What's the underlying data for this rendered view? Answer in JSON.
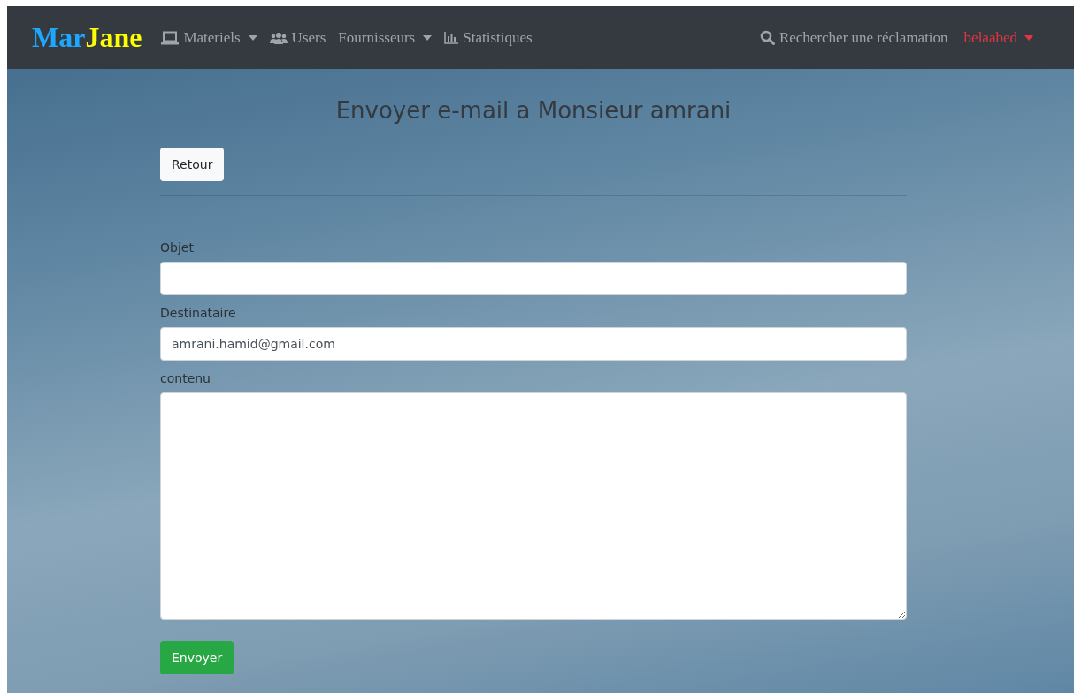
{
  "navbar": {
    "logo": [
      {
        "text": "Mar",
        "color": "#1ea7fd"
      },
      {
        "text": "Jane",
        "color": "#ffff00"
      }
    ],
    "items": [
      {
        "label": "Materiels",
        "dropdown": true
      },
      {
        "label": "Users",
        "dropdown": false
      },
      {
        "label": "Fournisseurs",
        "dropdown": true
      },
      {
        "label": "Statistiques",
        "dropdown": false
      }
    ],
    "search_link": "Rechercher une réclamation",
    "user": {
      "label": "belaabed",
      "dropdown": true
    }
  },
  "page": {
    "title": "Envoyer e-mail a Monsieur amrani",
    "back_button": "Retour",
    "fields": [
      {
        "label": "Objet",
        "kind": "input"
      },
      {
        "label": "Destinataire",
        "kind": "input",
        "value": "amrani.hamid@gmail.com"
      },
      {
        "label": "contenu",
        "kind": "textarea"
      }
    ],
    "submit_button": "Envoyer"
  }
}
